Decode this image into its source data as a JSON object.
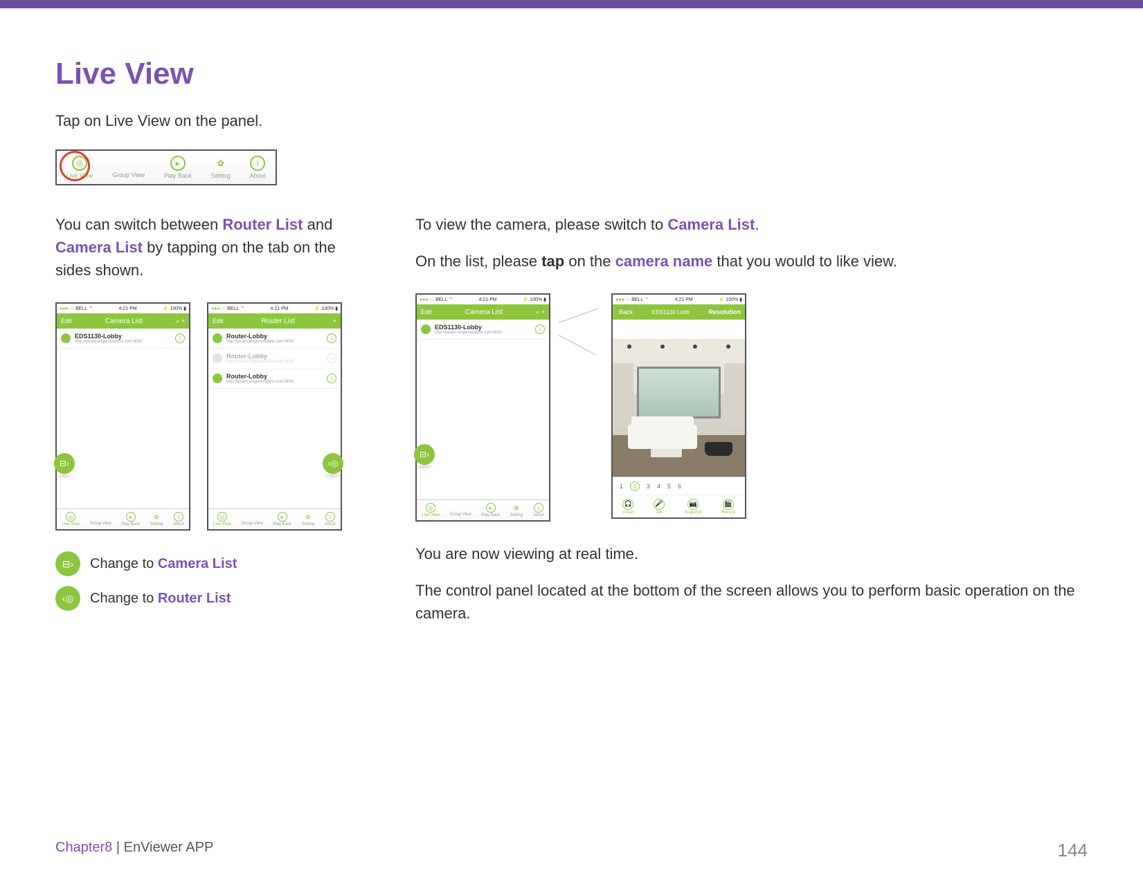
{
  "page": {
    "title": "Live View",
    "intro": "Tap on Live View on the panel.",
    "chapter": "Chapter8",
    "app_name": "EnViewer APP",
    "page_number": "144"
  },
  "panel_tabs": {
    "live_view": "Live View",
    "group_view": "Group View",
    "play_back": "Play Back",
    "setting": "Setting",
    "about": "About"
  },
  "left_col": {
    "p1_pre": "You can switch between ",
    "router_list": "Router List",
    "p1_mid": " and ",
    "camera_list": "Camera List",
    "p1_post": " by tapping on the tab on the sides shown.",
    "legend_camera": "Change to ",
    "legend_camera_kw": "Camera List",
    "legend_router": "Change to ",
    "legend_router_kw": "Router List"
  },
  "right_col": {
    "p1_pre": "To view the camera, please switch to ",
    "p1_kw": "Camera List",
    "p1_post": ".",
    "p2_pre": "On the list, please ",
    "p2_tap": "tap",
    "p2_mid": " on the ",
    "p2_kw": "camera name",
    "p2_post": " that you would to like view.",
    "p3": "You are now viewing at real time.",
    "p4": "The control panel located at the bottom of the screen allows you to perform basic operation on the camera."
  },
  "status": {
    "carrier_dots": "●●●○○",
    "carrier": "BELL",
    "wifi": "⌔",
    "time": "4:21 PM",
    "bt": "⚡",
    "battery": "100%"
  },
  "phone_camera_list": {
    "edit": "Edit",
    "title": "Camera List",
    "search_icon": "⌕",
    "add_icon": "+",
    "items": [
      {
        "name": "EDS1130-Lobby",
        "url": "http://ipcam.engeniusddns.com:8092"
      }
    ]
  },
  "phone_router_list": {
    "edit": "Edit",
    "title": "Router List",
    "add_icon": "+",
    "items": [
      {
        "name": "Router-Lobby",
        "url": "http://ipcam.engeniusddns.com:8092",
        "faded": false
      },
      {
        "name": "Router-Lobby",
        "url": "http://ipcam.engeniusddns.com:8092",
        "faded": true
      },
      {
        "name": "Router-Lobby",
        "url": "http://ipcam.engeniusddns.com:8092",
        "faded": false
      }
    ]
  },
  "phone_view": {
    "back": "Back",
    "title": "EDS1130 Lobb",
    "resolution": "Resolution",
    "pages": [
      "1",
      "2",
      "3",
      "4",
      "5",
      "6"
    ],
    "active_page": "2",
    "controls": {
      "listen": "Listen",
      "talk": "Talk",
      "snapshot": "Snapshot",
      "record": "Record"
    }
  },
  "bottom_tabs": {
    "live_view": "Live View",
    "group_view": "Group View",
    "play_back": "Play Back",
    "setting": "Setting",
    "about": "About"
  }
}
